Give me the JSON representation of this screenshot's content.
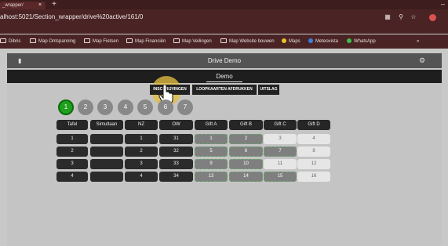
{
  "browser": {
    "tab_title": "_wrapper/",
    "tab_close": "×",
    "new_tab": "+",
    "url": "alhost:5021/Section_wrapper/drive%20active/161/0",
    "menu": "»",
    "minimize": "–",
    "bookmarks": [
      {
        "label": "Dibris",
        "icon": "folder-icon"
      },
      {
        "label": "Map Ontspanning",
        "icon": "folder-icon"
      },
      {
        "label": "Map Fietsen",
        "icon": "folder-icon"
      },
      {
        "label": "Map Financiën",
        "icon": "folder-icon"
      },
      {
        "label": "Map Veilingen",
        "icon": "folder-icon"
      },
      {
        "label": "Map Website bouwen",
        "icon": "folder-icon"
      },
      {
        "label": "Maps",
        "icon": "maps-pin-icon"
      },
      {
        "label": "Meteovista",
        "icon": "weather-icon"
      },
      {
        "label": "WhatsApp",
        "icon": "whatsapp-icon"
      }
    ]
  },
  "app": {
    "title": "Drive Demo",
    "event_name": "Demo",
    "tabs": [
      "INSCHRIJVINGEN",
      "LOOPKAARTEN AFDRUKKEN",
      "UITSLAG"
    ],
    "active_tab": 0,
    "rounds": [
      "1",
      "2",
      "3",
      "4",
      "5",
      "6",
      "7"
    ],
    "active_round": 0,
    "colors": {
      "active_round": "#1ea01e",
      "highlight": "#e2bc40"
    }
  },
  "table": {
    "headers": [
      "Tafel",
      "Simultaan",
      "NZ",
      "OW",
      "Gift A",
      "Gift B",
      "Gift C",
      "Gift D"
    ],
    "rows": [
      {
        "tafel": "1",
        "simultaan": "",
        "nz": "1",
        "ow": "31",
        "gifts": [
          "1",
          "2",
          "3",
          "4"
        ]
      },
      {
        "tafel": "2",
        "simultaan": "",
        "nz": "2",
        "ow": "32",
        "gifts": [
          "5",
          "6",
          "7",
          "8"
        ]
      },
      {
        "tafel": "3",
        "simultaan": "",
        "nz": "3",
        "ow": "33",
        "gifts": [
          "9",
          "10",
          "11",
          "12"
        ]
      },
      {
        "tafel": "4",
        "simultaan": "",
        "nz": "4",
        "ow": "34",
        "gifts": [
          "13",
          "14",
          "15",
          "16"
        ]
      }
    ]
  }
}
